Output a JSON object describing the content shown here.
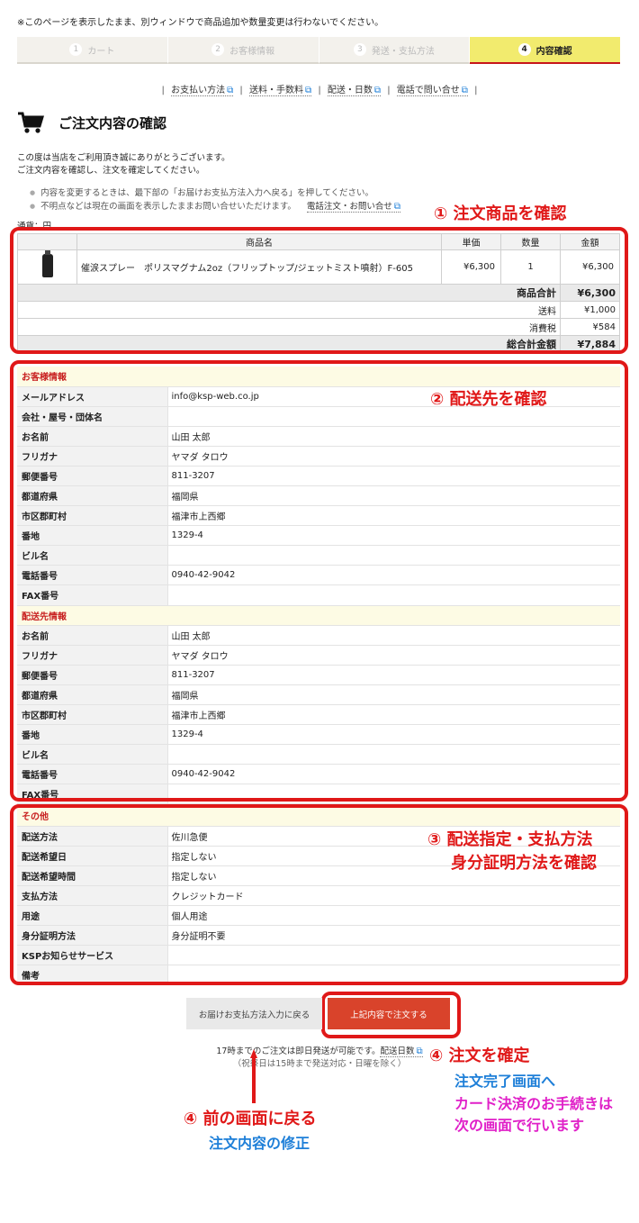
{
  "notice": "※このページを表示したまま、別ウィンドウで商品追加や数量変更は行わないでください。",
  "steps": [
    {
      "num": "1",
      "label": "カート"
    },
    {
      "num": "2",
      "label": "お客様情報"
    },
    {
      "num": "3",
      "label": "発送・支払方法"
    },
    {
      "num": "4",
      "label": "内容確認"
    }
  ],
  "links": [
    "お支払い方法",
    "送料・手数料",
    "配送・日数",
    "電話で問い合せ"
  ],
  "page_title": "ご注文内容の確認",
  "intro": [
    "この度は当店をご利用頂き誠にありがとうございます。",
    "ご注文内容を確認し、注文を確定してください。"
  ],
  "bullets": {
    "b1": "内容を変更するときは、最下部の「お届けお支払方法入力へ戻る」を押してください。",
    "b2": "不明点などは現在の画面を表示したままお問い合せいただけます。",
    "b2_link": "電話注文・お問い合せ"
  },
  "currency": "通貨：円",
  "product_table": {
    "headers": {
      "name": "商品名",
      "unit": "単価",
      "qty": "数量",
      "amount": "金額"
    },
    "item": {
      "name": "催涙スプレー　ポリスマグナム2oz（フリップトップ/ジェットミスト噴射）F-605",
      "unit": "¥6,300",
      "qty": "1",
      "amount": "¥6,300"
    },
    "subtotal_label": "商品合計",
    "subtotal": "¥6,300",
    "shipping_label": "送料",
    "shipping": "¥1,000",
    "tax_label": "消費税",
    "tax": "¥584",
    "total_label": "総合計金額",
    "total": "¥7,884"
  },
  "customer": {
    "section": "お客様情報",
    "rows": [
      {
        "k": "メールアドレス",
        "v": "info@ksp-web.co.jp"
      },
      {
        "k": "会社・屋号・団体名",
        "v": ""
      },
      {
        "k": "お名前",
        "v": "山田 太郎"
      },
      {
        "k": "フリガナ",
        "v": "ヤマダ タロウ"
      },
      {
        "k": "郵便番号",
        "v": "811-3207"
      },
      {
        "k": "都道府県",
        "v": "福岡県"
      },
      {
        "k": "市区郡町村",
        "v": "福津市上西郷"
      },
      {
        "k": "番地",
        "v": "1329-4"
      },
      {
        "k": "ビル名",
        "v": ""
      },
      {
        "k": "電話番号",
        "v": "0940-42-9042"
      },
      {
        "k": "FAX番号",
        "v": ""
      }
    ]
  },
  "delivery": {
    "section": "配送先情報",
    "rows": [
      {
        "k": "お名前",
        "v": "山田 太郎"
      },
      {
        "k": "フリガナ",
        "v": "ヤマダ タロウ"
      },
      {
        "k": "郵便番号",
        "v": "811-3207"
      },
      {
        "k": "都道府県",
        "v": "福岡県"
      },
      {
        "k": "市区郡町村",
        "v": "福津市上西郷"
      },
      {
        "k": "番地",
        "v": "1329-4"
      },
      {
        "k": "ビル名",
        "v": ""
      },
      {
        "k": "電話番号",
        "v": "0940-42-9042"
      },
      {
        "k": "FAX番号",
        "v": ""
      }
    ]
  },
  "other": {
    "section": "その他",
    "rows": [
      {
        "k": "配送方法",
        "v": "佐川急便"
      },
      {
        "k": "配送希望日",
        "v": "指定しない"
      },
      {
        "k": "配送希望時間",
        "v": "指定しない"
      },
      {
        "k": "支払方法",
        "v": "クレジットカード"
      },
      {
        "k": "用途",
        "v": "個人用途"
      },
      {
        "k": "身分証明方法",
        "v": "身分証明不要"
      },
      {
        "k": "KSPお知らせサービス",
        "v": ""
      },
      {
        "k": "備考",
        "v": ""
      }
    ]
  },
  "buttons": {
    "back": "お届けお支払方法入力に戻る",
    "order": "上記内容で注文する"
  },
  "ship_note": {
    "pre": "17時までのご注文は即日発送が可能です。",
    "link": "配送日数",
    "sub": "（祝祭日は15時まで発送対応・日曜を除く）"
  },
  "annotations": {
    "a1": "① 注文商品を確認",
    "a2": "② 配送先を確認",
    "a3_1": "③ 配送指定・支払方法",
    "a3_2": "身分証明方法を確認",
    "a4_confirm": "④ 注文を確定",
    "a4_complete": "注文完了画面へ",
    "a4_card1": "カード決済のお手続きは",
    "a4_card2": "次の画面で行います",
    "a4_back": "④ 前の画面に戻る",
    "a4_fix": "注文内容の修正"
  },
  "colors": {
    "accent_red": "#e01818",
    "step_active": "#f2eb6e",
    "order_button": "#d9432b",
    "annotation_blue": "#1e7fd8",
    "annotation_pink": "#e020c8"
  }
}
